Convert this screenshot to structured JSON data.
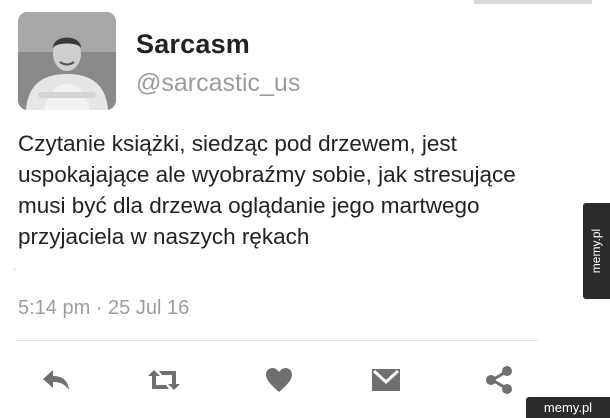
{
  "account": {
    "display_name": "Sarcasm",
    "handle": "@sarcastic_us",
    "avatar_icon": "profile-photo"
  },
  "tweet": {
    "lines": [
      "Czytanie książki, siedząc pod drzewem, jest",
      "uspokajające ale wyobraźmy sobie, jak stresujące",
      "musi być dla drzewa oglądanie jego martwego",
      "przyjaciela w naszych rękach"
    ],
    "timestamp": "5:14 pm · 25 Jul 16"
  },
  "actions": [
    {
      "name": "reply",
      "icon": "reply-icon"
    },
    {
      "name": "retweet",
      "icon": "retweet-icon"
    },
    {
      "name": "like",
      "icon": "heart-icon"
    },
    {
      "name": "direct-message",
      "icon": "envelope-icon"
    },
    {
      "name": "share",
      "icon": "share-icon"
    }
  ],
  "watermark": {
    "side": "memy.pl",
    "corner": "memy.pl"
  },
  "colors": {
    "text": "#222222",
    "muted": "#9b9b9b",
    "icon": "#6f6f6f",
    "divider": "#e4e4e4",
    "watermark_bg": "#2b2b2b"
  }
}
